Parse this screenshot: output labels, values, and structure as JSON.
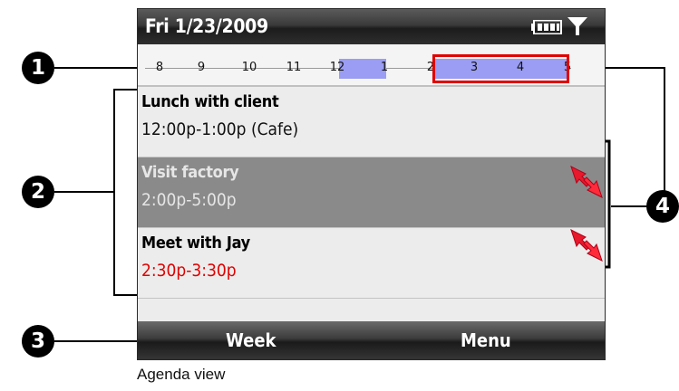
{
  "titlebar": {
    "date": "Fri 1/23/2009",
    "icons": [
      "battery-icon",
      "signal-icon"
    ]
  },
  "timeline": {
    "hours": [
      "8",
      "9",
      "10",
      "11",
      "12",
      "1",
      "2",
      "3",
      "4",
      "5"
    ],
    "scheduled_blocks": [
      {
        "from": "12",
        "to": "1",
        "color": "#9a9df3"
      },
      {
        "from": "2",
        "to": "5",
        "color": "#9a9df3"
      }
    ],
    "highlight_color": "#e00000"
  },
  "agenda": [
    {
      "name": "Lunch with client",
      "time": "12:00p-1:00p (Cafe)",
      "selected": false,
      "conflict": false,
      "time_color": "#111111"
    },
    {
      "name": "Visit factory",
      "time": "2:00p-5:00p",
      "selected": true,
      "conflict": true,
      "time_color": "#e6e6e6"
    },
    {
      "name": "Meet with Jay",
      "time": "2:30p-3:30p",
      "selected": false,
      "conflict": true,
      "time_color": "#e00000"
    }
  ],
  "softkeys": {
    "left": "Week",
    "right": "Menu"
  },
  "callouts": [
    "1",
    "2",
    "3",
    "4"
  ],
  "caption": "Agenda view"
}
